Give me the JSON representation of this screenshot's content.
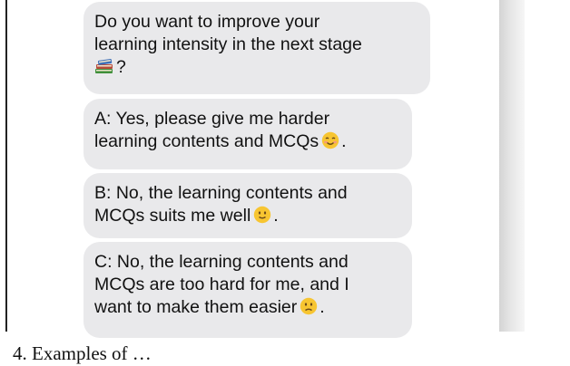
{
  "chat": {
    "question": {
      "line1": "Do you want to improve your",
      "line2": "learning intensity in the next stage",
      "line3_suffix": "?"
    },
    "option_a": {
      "line1": "A: Yes, please give me harder",
      "line2": "learning contents and MCQs",
      "end": "."
    },
    "option_b": {
      "line1": "B: No, the learning contents and",
      "line2": "MCQs suits me well",
      "end": "."
    },
    "option_c": {
      "line1": "C: No, the learning contents and",
      "line2": "MCQs are too hard for me, and I",
      "line3": "want to make them easier",
      "end": "."
    }
  },
  "icons": {
    "question": "books-emoji-icon",
    "option_a": "smiling-face-emoji-icon",
    "option_b": "slightly-smiling-face-emoji-icon",
    "option_c": "slightly-frowning-face-emoji-icon"
  },
  "caption": "4.  Examples of …"
}
